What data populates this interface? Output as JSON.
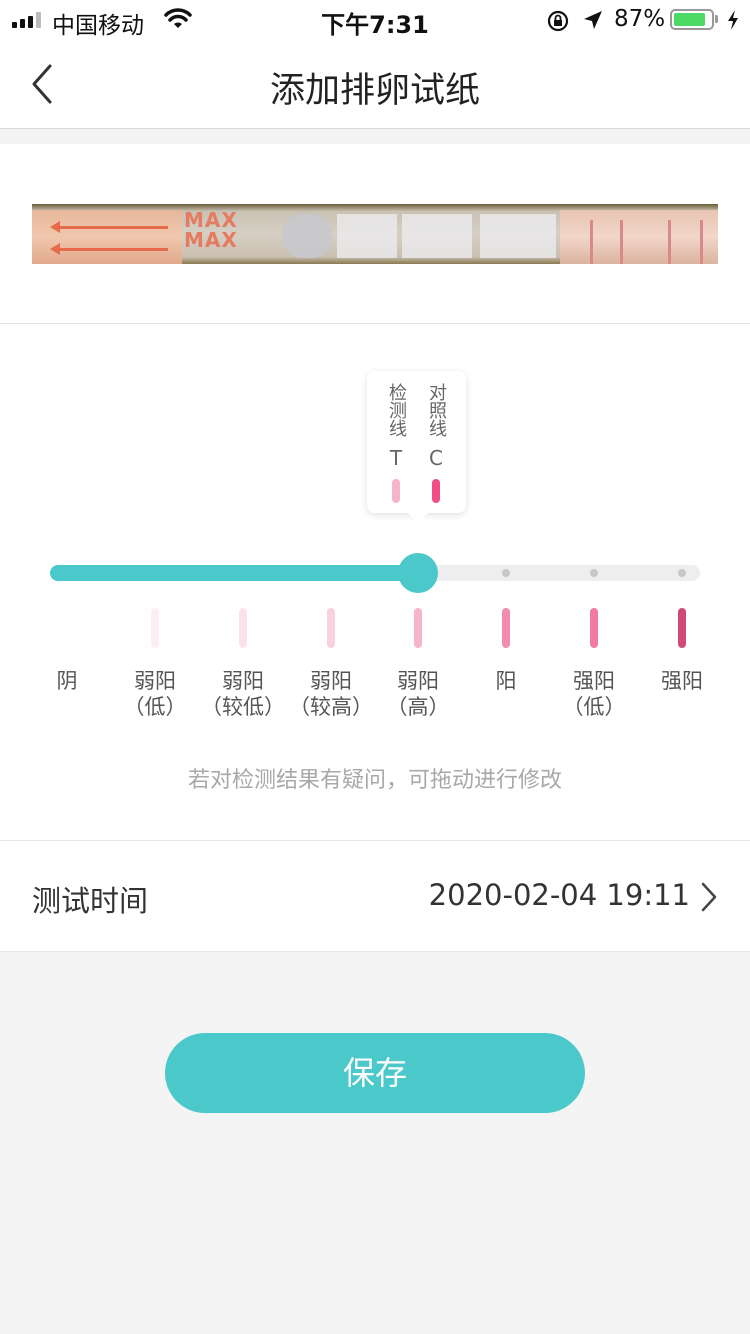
{
  "status_bar": {
    "carrier": "中国移动",
    "time": "下午7:31",
    "battery_percent": "87%",
    "battery_level": 0.87,
    "icons": [
      "signal-icon",
      "wifi-icon",
      "orientation-lock-icon",
      "location-icon",
      "battery-icon",
      "charging-icon"
    ]
  },
  "nav": {
    "title": "添加排卵试纸",
    "back_icon": "chevron-left-icon"
  },
  "strip": {
    "max_text": "MAX"
  },
  "tooltip": {
    "test_line_label": "检测线",
    "control_line_label": "对照线",
    "test_letter": "T",
    "control_letter": "C",
    "test_color": "#f6b3cc",
    "control_color": "#ef4f86"
  },
  "slider": {
    "selected_index": 3,
    "level_count": 7,
    "track_color": "#eeeeee",
    "fill_color": "#4ac8ca"
  },
  "levels": [
    {
      "label": "阴",
      "sub": "",
      "color": ""
    },
    {
      "label": "弱阳",
      "sub": "（低）",
      "color": "#fdeef2"
    },
    {
      "label": "弱阳",
      "sub": "（较低）",
      "color": "#fbe2ea"
    },
    {
      "label": "弱阳",
      "sub": "（较高）",
      "color": "#f9d2df"
    },
    {
      "label": "弱阳",
      "sub": "（高）",
      "color": "#f6b3cc"
    },
    {
      "label": "阳",
      "sub": "",
      "color": "#f28cb1"
    },
    {
      "label": "强阳",
      "sub": "（低）",
      "color": "#f07aa2"
    },
    {
      "label": "强阳",
      "sub": "",
      "color": "#cf4a78"
    }
  ],
  "hint": "若对检测结果有疑问，可拖动进行修改",
  "test_time": {
    "label": "测试时间",
    "value": "2020-02-04 19:11"
  },
  "save_label": "保存",
  "accent_color": "#4ac8ca"
}
